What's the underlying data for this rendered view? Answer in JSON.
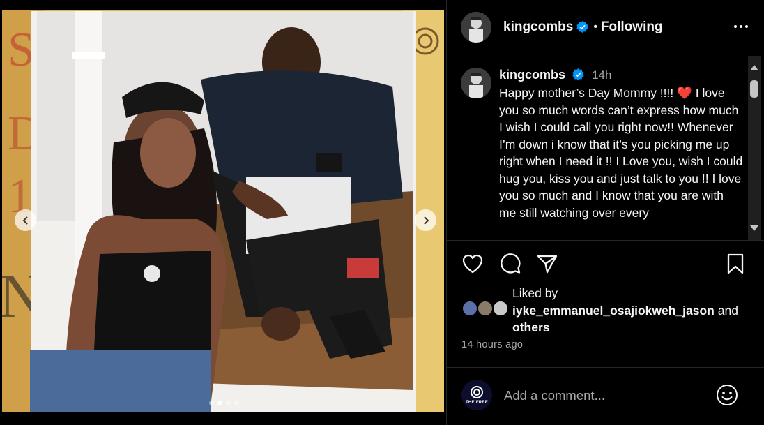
{
  "post": {
    "username": "kingcombs",
    "verified": true,
    "follow_status": "Following",
    "separator": "•"
  },
  "caption": {
    "username": "kingcombs",
    "time": "14h",
    "text": "Happy mother’s Day Mommy !!!! ❤️ I love you so much words can’t express how much I wish I could call you right now!! Whenever I’m down i know that it’s you picking me up right when I need it !! I Love you, wish I could hug you, kiss you and just talk to you !! I love you so much and I know that you are with me still watching over every"
  },
  "carousel": {
    "total": 4,
    "active": 1
  },
  "likes": {
    "prefix": "Liked by",
    "user": "iyke_emmanuel_osajiokweh_jason",
    "conjunction": "and",
    "suffix": "others"
  },
  "time_ago": "14 hours ago",
  "comment": {
    "placeholder": "Add a comment...",
    "avatar_label": "THE FREE"
  },
  "icons": {
    "more": "more-dots-icon",
    "verified": "verified-badge-icon",
    "like": "heart-icon",
    "comment": "comment-bubble-icon",
    "share": "paper-plane-icon",
    "save": "bookmark-icon",
    "emoji": "emoji-smiley-icon",
    "prev": "chevron-left-icon",
    "next": "chevron-right-icon"
  },
  "colors": {
    "background": "#000000",
    "verified": "#0095f6",
    "heart": "#ed4956",
    "muted": "#a8a8a8"
  }
}
